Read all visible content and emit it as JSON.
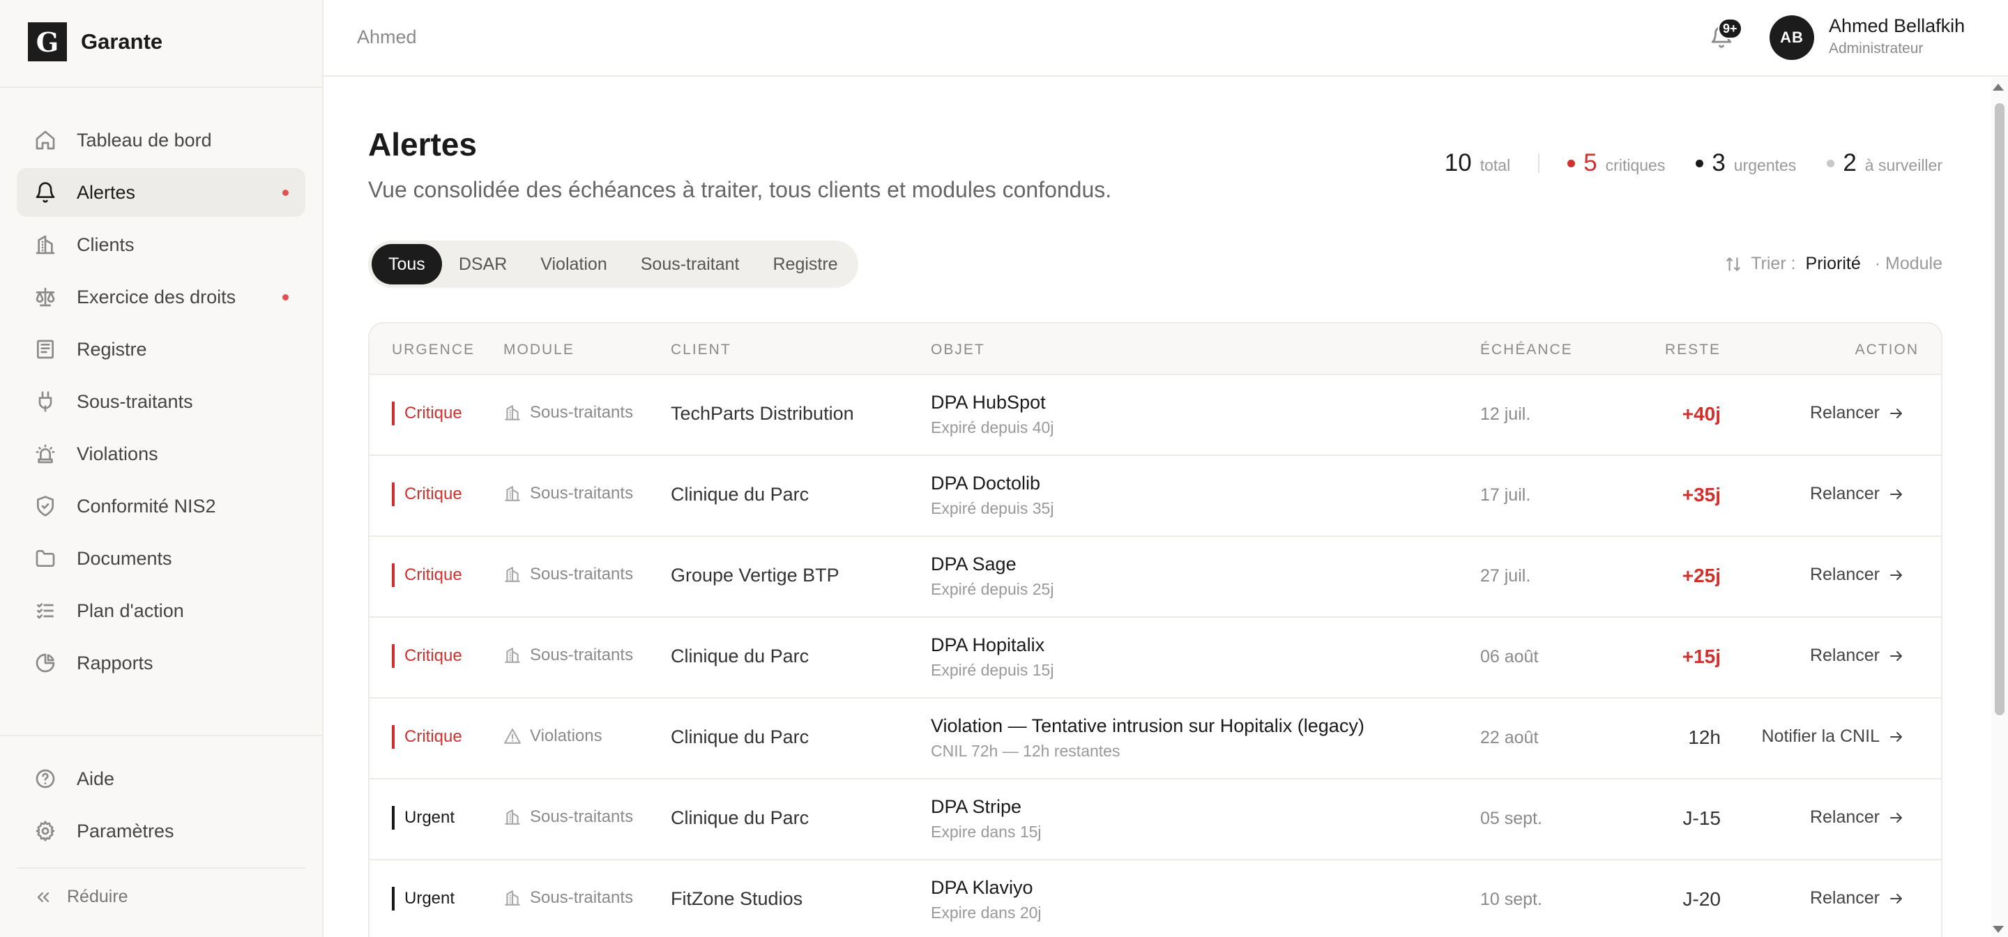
{
  "app": {
    "logo_letter": "G",
    "name": "Garante"
  },
  "sidebar": {
    "items": [
      {
        "label": "Tableau de bord",
        "icon": "home-icon",
        "active": false,
        "dot": false
      },
      {
        "label": "Alertes",
        "icon": "bell-icon",
        "active": true,
        "dot": true
      },
      {
        "label": "Clients",
        "icon": "building-icon",
        "active": false,
        "dot": false
      },
      {
        "label": "Exercice des droits",
        "icon": "scale-icon",
        "active": false,
        "dot": true
      },
      {
        "label": "Registre",
        "icon": "register-icon",
        "active": false,
        "dot": false
      },
      {
        "label": "Sous-traitants",
        "icon": "plug-icon",
        "active": false,
        "dot": false
      },
      {
        "label": "Violations",
        "icon": "siren-icon",
        "active": false,
        "dot": false
      },
      {
        "label": "Conformité NIS2",
        "icon": "shield-icon",
        "active": false,
        "dot": false
      },
      {
        "label": "Documents",
        "icon": "folder-icon",
        "active": false,
        "dot": false
      },
      {
        "label": "Plan d'action",
        "icon": "checklist-icon",
        "active": false,
        "dot": false
      },
      {
        "label": "Rapports",
        "icon": "pie-chart-icon",
        "active": false,
        "dot": false
      }
    ],
    "bottom_items": [
      {
        "label": "Aide",
        "icon": "help-icon"
      },
      {
        "label": "Paramètres",
        "icon": "gear-icon"
      }
    ],
    "collapse_label": "Réduire"
  },
  "topbar": {
    "breadcrumb": "Ahmed",
    "notif_count": "9+",
    "user": {
      "initials": "AB",
      "name": "Ahmed Bellafkih",
      "role": "Administrateur"
    }
  },
  "page": {
    "title": "Alertes",
    "subtitle": "Vue consolidée des échéances à traiter, tous clients et modules confondus."
  },
  "stats": {
    "total": {
      "value": "10",
      "label": "total"
    },
    "critical": {
      "value": "5",
      "label": "critiques",
      "color": "#d0312d"
    },
    "urgent": {
      "value": "3",
      "label": "urgentes",
      "color": "#1a1a1a"
    },
    "watch": {
      "value": "2",
      "label": "à surveiller",
      "color": "#c8c8c8"
    }
  },
  "filters": {
    "tabs": [
      "Tous",
      "DSAR",
      "Violation",
      "Sous-traitant",
      "Registre"
    ],
    "active": "Tous"
  },
  "sort": {
    "label": "Trier :",
    "active": "Priorité",
    "option": "· Module"
  },
  "table": {
    "headers": {
      "urgency": "URGENCE",
      "module": "MODULE",
      "client": "CLIENT",
      "object": "OBJET",
      "due": "ÉCHÉANCE",
      "remaining": "RESTE",
      "action": "ACTION"
    },
    "rows": [
      {
        "urgency": "Critique",
        "level": "critical",
        "module": "Sous-traitants",
        "module_icon": "building-icon",
        "client": "TechParts Distribution",
        "object": "DPA HubSpot",
        "object_sub": "Expiré depuis 40j",
        "due": "12 juil.",
        "remaining": "+40j",
        "action": "Relancer"
      },
      {
        "urgency": "Critique",
        "level": "critical",
        "module": "Sous-traitants",
        "module_icon": "building-icon",
        "client": "Clinique du Parc",
        "object": "DPA Doctolib",
        "object_sub": "Expiré depuis 35j",
        "due": "17 juil.",
        "remaining": "+35j",
        "action": "Relancer"
      },
      {
        "urgency": "Critique",
        "level": "critical",
        "module": "Sous-traitants",
        "module_icon": "building-icon",
        "client": "Groupe Vertige BTP",
        "object": "DPA Sage",
        "object_sub": "Expiré depuis 25j",
        "due": "27 juil.",
        "remaining": "+25j",
        "action": "Relancer"
      },
      {
        "urgency": "Critique",
        "level": "critical",
        "module": "Sous-traitants",
        "module_icon": "building-icon",
        "client": "Clinique du Parc",
        "object": "DPA Hopitalix",
        "object_sub": "Expiré depuis 15j",
        "due": "06 août",
        "remaining": "+15j",
        "action": "Relancer"
      },
      {
        "urgency": "Critique",
        "level": "critical",
        "module": "Violations",
        "module_icon": "warning-icon",
        "client": "Clinique du Parc",
        "object": "Violation — Tentative intrusion sur Hopitalix (legacy)",
        "object_sub": "CNIL 72h — 12h restantes",
        "due": "22 août",
        "remaining": "12h",
        "action": "Notifier la CNIL"
      },
      {
        "urgency": "Urgent",
        "level": "urgent",
        "module": "Sous-traitants",
        "module_icon": "building-icon",
        "client": "Clinique du Parc",
        "object": "DPA Stripe",
        "object_sub": "Expire dans 15j",
        "due": "05 sept.",
        "remaining": "J-15",
        "action": "Relancer"
      },
      {
        "urgency": "Urgent",
        "level": "urgent",
        "module": "Sous-traitants",
        "module_icon": "building-icon",
        "client": "FitZone Studios",
        "object": "DPA Klaviyo",
        "object_sub": "Expire dans 20j",
        "due": "10 sept.",
        "remaining": "J-20",
        "action": "Relancer"
      }
    ]
  },
  "colors": {
    "critical": "#d0312d",
    "urgent": "#1a1a1a",
    "accent": "#1c1c1c"
  }
}
